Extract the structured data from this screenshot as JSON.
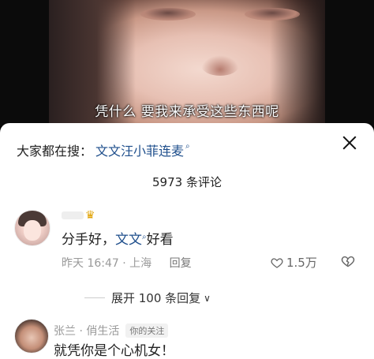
{
  "video": {
    "subtitle": "凭什么 要我来承受这些东西呢"
  },
  "comments_panel": {
    "search_prefix": "大家都在搜：",
    "search_term": "文文汪小菲连麦",
    "search_icon": "search-icon",
    "close_icon": "close-icon",
    "count_label": "5973 条评论"
  },
  "comment1": {
    "username_icon": "crown-icon",
    "text_before": "分手好，",
    "link_text": "文文",
    "text_after": "好看",
    "time": "昨天 16:47 · 上海",
    "reply_label": "回复",
    "likes": "1.5万",
    "expand_label": "展开 100 条回复"
  },
  "comment2": {
    "username": "张兰 · 俏生活",
    "badge": "你的关注",
    "text": "就凭你是个心机女！"
  },
  "colors": {
    "link": "#1f4f8c",
    "muted": "#999999"
  }
}
